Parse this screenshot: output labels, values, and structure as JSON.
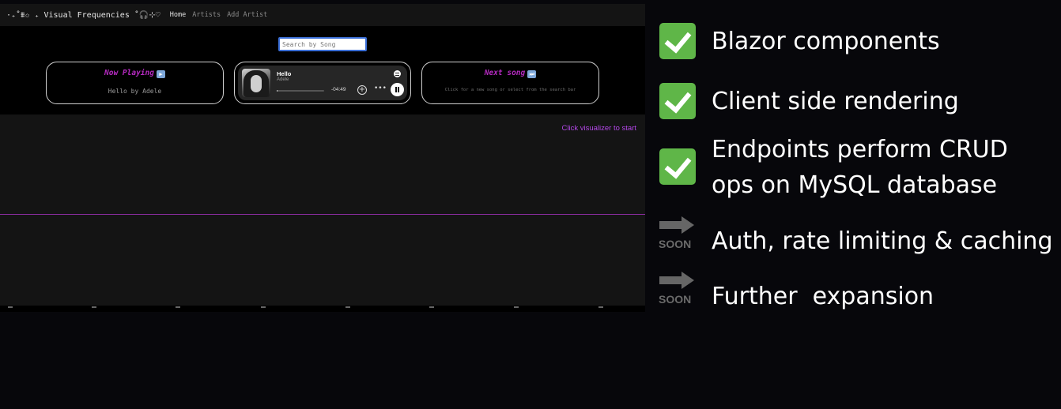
{
  "app": {
    "brand": "·₊˚⩩✩ ₊ Visual Frequencies ˚🎧⊹♡",
    "nav": {
      "home": "Home",
      "artists": "Artists",
      "add_artist": "Add Artist"
    },
    "search": {
      "placeholder": "Search by Song",
      "value": ""
    },
    "now_playing": {
      "title": "Now Playing",
      "song": "Hello by Adele"
    },
    "player": {
      "track": "Hello",
      "artist": "Adele",
      "time_remaining": "-04:49",
      "progress": 0.02
    },
    "next_song": {
      "title": "Next song",
      "hint": "Click for a new song or select from the search bar"
    },
    "visualizer": {
      "hint": "Click visualizer to start"
    }
  },
  "features": [
    {
      "status": "done",
      "icon": "check-icon",
      "lines": [
        "Blazor components"
      ]
    },
    {
      "status": "done",
      "icon": "check-icon",
      "lines": [
        "Client side rendering"
      ]
    },
    {
      "status": "done",
      "icon": "check-icon",
      "lines": [
        "Endpoints perform CRUD",
        "ops on MySQL database"
      ]
    },
    {
      "status": "soon",
      "icon": "arrow-right-icon",
      "badge": "SOON",
      "lines": [
        "Auth, rate limiting & caching"
      ]
    },
    {
      "status": "soon",
      "icon": "arrow-right-icon",
      "badge": "SOON",
      "lines": [
        "Further  expansion"
      ]
    }
  ],
  "colors": {
    "accent_purple": "#b52ac0",
    "check_green": "#5fb648",
    "soon_gray": "#666666"
  }
}
